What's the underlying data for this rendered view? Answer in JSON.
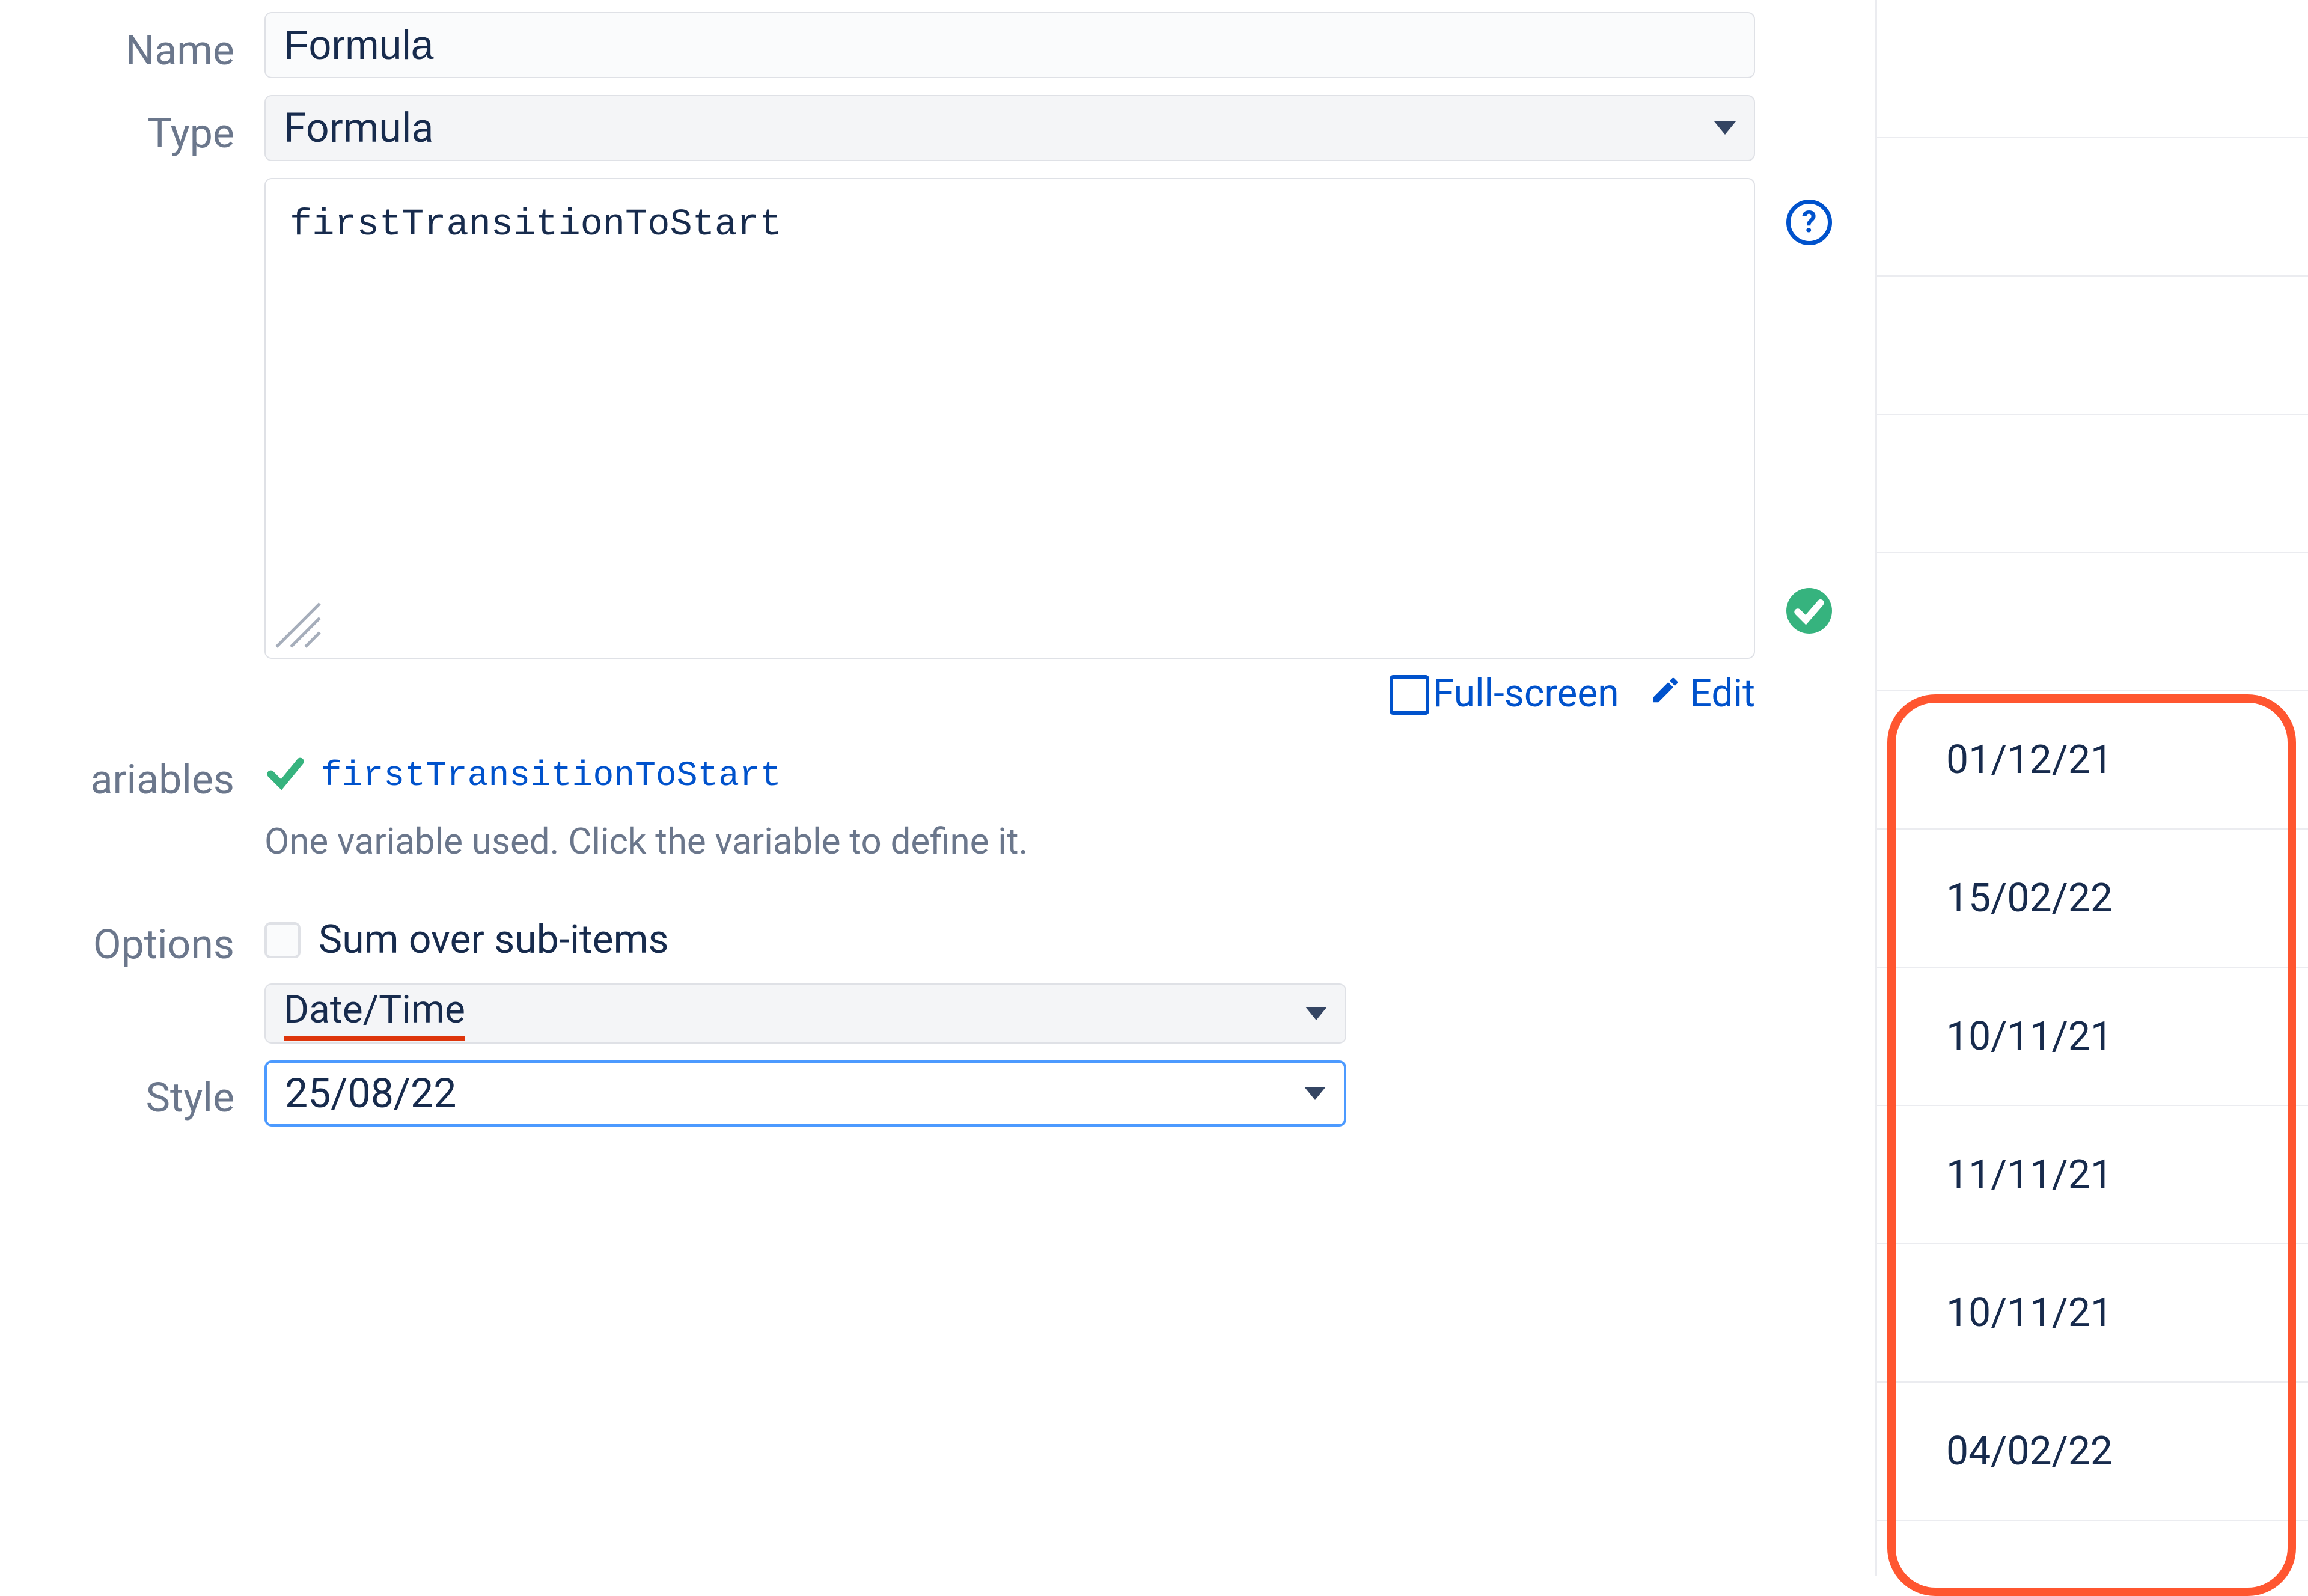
{
  "form": {
    "name": {
      "label": "Name",
      "value": "Formula"
    },
    "type": {
      "label": "Type",
      "value": "Formula"
    },
    "formula": {
      "value": "firstTransitionToStart"
    },
    "links": {
      "fullscreen": "Full-screen",
      "edit": "Edit"
    },
    "variables": {
      "label": "ariables",
      "name": "firstTransitionToStart",
      "hint": "One variable used. Click the variable to define it."
    },
    "options": {
      "label": "Options",
      "sum_label": "Sum over sub-items",
      "type_value": "Date/Time"
    },
    "style": {
      "label": "Style",
      "value": "25/08/22"
    }
  },
  "dates": [
    "01/12/21",
    "15/02/22",
    "10/11/21",
    "11/11/21",
    "10/11/21",
    "04/02/22"
  ]
}
